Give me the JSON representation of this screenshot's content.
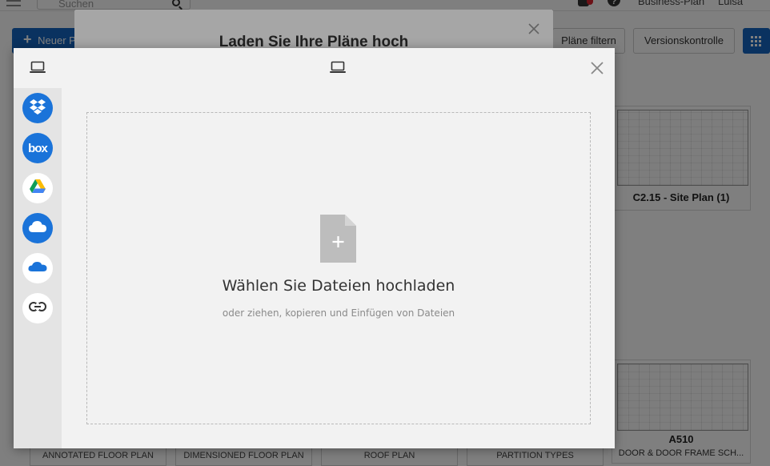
{
  "app": {
    "search_placeholder": "Suchen",
    "plan_label": "Business-Plan",
    "user_label": "Luisa",
    "new_button_label": "Neuer P",
    "filter_button_label": "Pläne filtern",
    "version_button_label": "Versionskontrolle"
  },
  "cards": {
    "c215_title": "C2.15 - Site Plan (1)",
    "a510_title": "A510",
    "a510_sub": "DOOR & DOOR FRAME SCH..."
  },
  "bottom_labels": [
    "ANNOTATED FLOOR PLAN",
    "DIMENSIONED FLOOR PLAN",
    "ROOF PLAN",
    "PARTITION TYPES"
  ],
  "upload_modal": {
    "title": "Laden Sie Ihre Pläne hoch"
  },
  "picker": {
    "sources": [
      "dropbox",
      "box",
      "google-drive",
      "icloud",
      "onedrive",
      "link"
    ],
    "box_text": "box",
    "dropzone": {
      "title": "Wählen Sie Dateien hochladen",
      "subtitle": "oder ziehen, kopieren und Einfügen von Dateien"
    }
  },
  "colors": {
    "accent": "#1565c0",
    "source_blue": "#1a73d9"
  }
}
